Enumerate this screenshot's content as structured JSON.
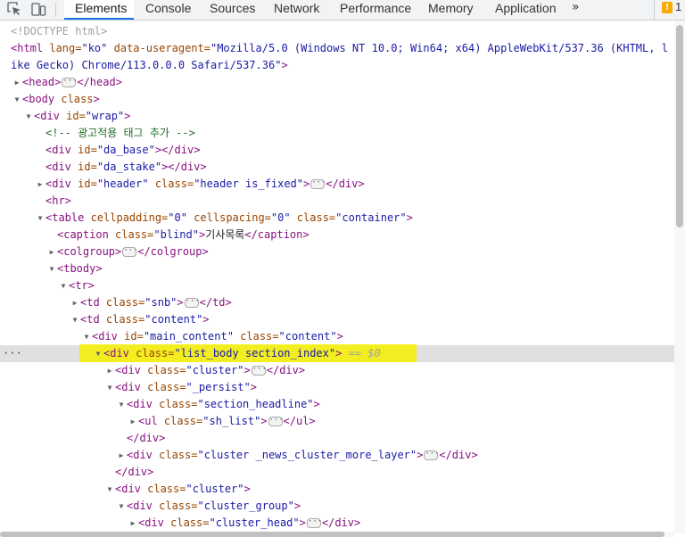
{
  "toolbar": {
    "inspect_icon": "inspect-element-icon",
    "device_icon": "device-toolbar-icon",
    "tabs": [
      "Elements",
      "Console",
      "Sources",
      "Network",
      "Performance",
      "Memory",
      "Application"
    ],
    "more_tabs": "»",
    "issues": {
      "badge": "!",
      "count": "1"
    }
  },
  "colors": {
    "tag": "#881280",
    "attr": "#994500",
    "value": "#1a1aa6",
    "comment": "#236e25",
    "highlight": "#f4f000",
    "selected_row": "#e0e0e0"
  },
  "tree": {
    "doctype": "<!DOCTYPE html>",
    "html_open": {
      "tag": "<html",
      "a1": " lang=",
      "v1": "\"ko\"",
      "a2": " data-useragent=",
      "v2": "\"Mozilla/5.0 (Windows NT 10.0; Win64; x64) AppleWebKit/537.36 (KHTML, l"
    },
    "html_wrap": {
      "v": "ike Gecko) Chrome/113.0.0.0 Safari/537.36\"",
      "close": ">"
    },
    "head": {
      "open": "<head>",
      "close": "</head>"
    },
    "body": {
      "tag": "<body",
      "a": " class",
      "close": ">"
    },
    "wrap": {
      "tag": "<div",
      "a": " id=",
      "v": "\"wrap\"",
      "close": ">"
    },
    "comment": "<!-- 광고적용 태그 추가 -->",
    "da_base": {
      "tag": "<div",
      "a": " id=",
      "v": "\"da_base\"",
      "close": "></div>"
    },
    "da_stake": {
      "tag": "<div",
      "a": " id=",
      "v": "\"da_stake\"",
      "close": "></div>"
    },
    "header": {
      "tag": "<div",
      "a1": " id=",
      "v1": "\"header\"",
      "a2": " class=",
      "v2": "\"header is_fixed\"",
      "close1": ">",
      "close2": "</div>"
    },
    "hr": "<hr>",
    "table": {
      "tag": "<table",
      "a1": " cellpadding=",
      "v1": "\"0\"",
      "a2": " cellspacing=",
      "v2": "\"0\"",
      "a3": " class=",
      "v3": "\"container\"",
      "close": ">"
    },
    "caption": {
      "tag": "<caption",
      "a": " class=",
      "v": "\"blind\"",
      "gt": ">",
      "text": "기사목록",
      "close": "</caption>"
    },
    "colgroup": {
      "open": "<colgroup>",
      "close": "</colgroup>"
    },
    "tbody": "<tbody>",
    "tr": "<tr>",
    "td_snb": {
      "tag": "<td",
      "a": " class=",
      "v": "\"snb\"",
      "close1": ">",
      "close2": "</td>"
    },
    "td_content": {
      "tag": "<td",
      "a": " class=",
      "v": "\"content\"",
      "close": ">"
    },
    "main_content": {
      "tag": "<div",
      "a1": " id=",
      "v1": "\"main_content\"",
      "a2": " class=",
      "v2": "\"content\"",
      "close": ">"
    },
    "list_body": {
      "tag": "<div",
      "a": " class=",
      "v": "\"list_body section_index\"",
      "close": ">",
      "eq": " == $0"
    },
    "cluster1": {
      "tag": "<div",
      "a": " class=",
      "v": "\"cluster\"",
      "close1": ">",
      "close2": "</div>"
    },
    "persist": {
      "tag": "<div",
      "a": " class=",
      "v": "\"_persist\"",
      "close": ">"
    },
    "section_headline": {
      "tag": "<div",
      "a": " class=",
      "v": "\"section_headline\"",
      "close": ">"
    },
    "sh_list": {
      "tag": "<ul",
      "a": " class=",
      "v": "\"sh_list\"",
      "close1": ">",
      "close2": "</ul>"
    },
    "div_close_a": "</div>",
    "cluster_more": {
      "tag": "<div",
      "a": " class=",
      "v": "\"cluster _news_cluster_more_layer\"",
      "close1": ">",
      "close2": "</div>"
    },
    "div_close_b": "</div>",
    "cluster2": {
      "tag": "<div",
      "a": " class=",
      "v": "\"cluster\"",
      "close": ">"
    },
    "cluster_group": {
      "tag": "<div",
      "a": " class=",
      "v": "\"cluster_group\"",
      "close": ">"
    },
    "cluster_head": {
      "tag": "<div",
      "a": " class=",
      "v": "\"cluster_head\"",
      "close1": ">",
      "close2": "</div>"
    },
    "ellipsis": "···",
    "row_dots": "···"
  }
}
